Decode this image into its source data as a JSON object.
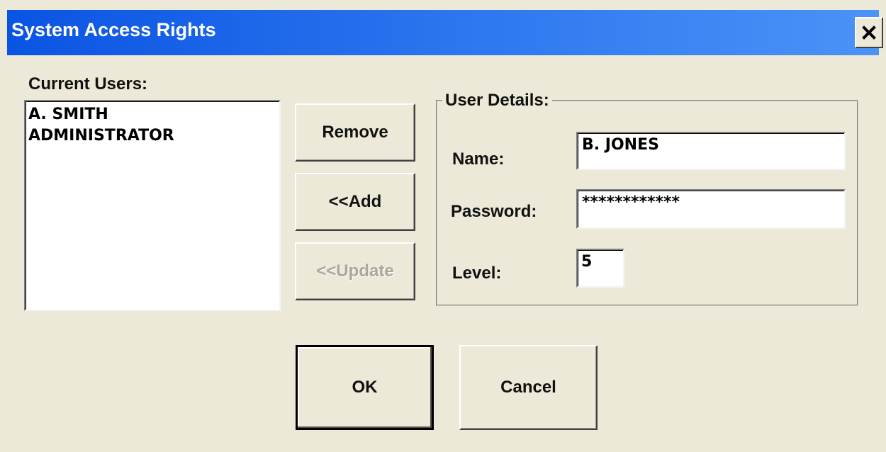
{
  "window": {
    "title": "System Access Rights"
  },
  "users": {
    "label": "Current Users:",
    "items": [
      "A. SMITH",
      "ADMINISTRATOR"
    ]
  },
  "actions": {
    "remove": "Remove",
    "add": "<<Add",
    "update": "<<Update"
  },
  "details": {
    "group_title": "User Details:",
    "name_label": "Name:",
    "name_value": "B. JONES",
    "password_label": "Password:",
    "password_value": "************",
    "level_label": "Level:",
    "level_value": "5"
  },
  "footer": {
    "ok": "OK",
    "cancel": "Cancel"
  },
  "icons": {
    "close": "close-icon"
  },
  "colors": {
    "titlebar": "#0a54e3",
    "window_bg": "#ece9d8",
    "disabled_text": "#a8a89c"
  }
}
